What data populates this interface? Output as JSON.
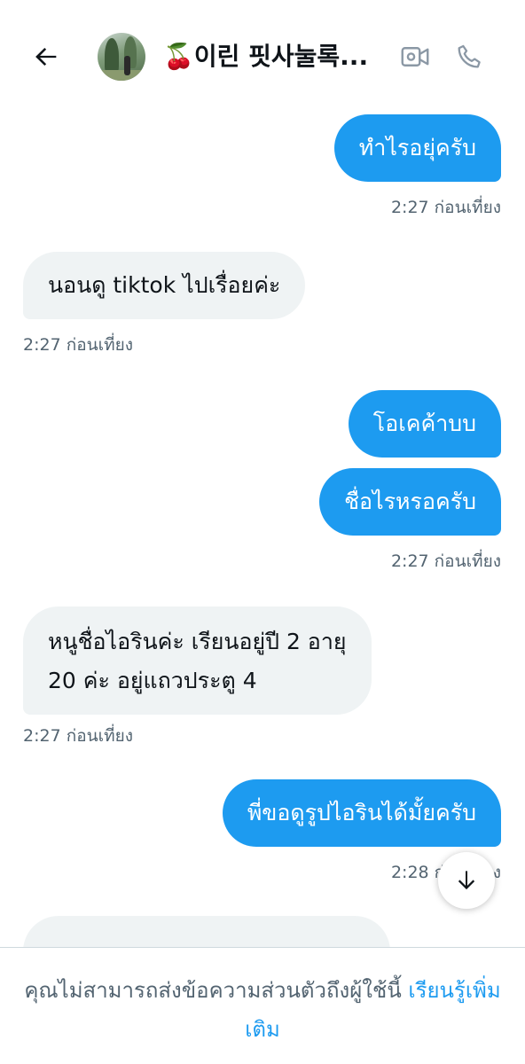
{
  "header": {
    "back_icon": "arrow-left-icon",
    "title": "🍒이린 핏사눌록...",
    "video_icon": "video-camera-icon",
    "call_icon": "phone-icon"
  },
  "messages": [
    {
      "direction": "outgoing",
      "text": "ทำไรอยุ่ครับ"
    },
    {
      "timestamp": "2:27 ก่อนเที่ยง"
    },
    {
      "direction": "incoming",
      "text": "นอนดู tiktok ไปเรื่อยค่ะ"
    },
    {
      "timestamp": "2:27 ก่อนเที่ยง"
    },
    {
      "direction": "outgoing",
      "text": "โอเคค้าบบ"
    },
    {
      "direction": "outgoing",
      "text": "ชื่อไรหรอครับ"
    },
    {
      "timestamp": "2:27 ก่อนเที่ยง"
    },
    {
      "direction": "incoming",
      "lines": [
        "หนูชื่อไอรินค่ะ เรียนอยู่ปี 2 อายุ",
        "20 ค่ะ อยู่แถวประตู 4"
      ]
    },
    {
      "timestamp": "2:27 ก่อนเที่ยง"
    },
    {
      "direction": "outgoing",
      "text": "พี่ขอดูรูปไอรินได้มั้ยครับ"
    },
    {
      "timestamp": "2:28 ก่อนเที่ยง"
    }
  ],
  "scroll_down_icon": "arrow-down-icon",
  "footer": {
    "notice": "คุณไม่สามารถส่งข้อความส่วนตัวถึงผู้ใช้นี้ ",
    "link": "เรียนรู้เพิ่มเติม"
  },
  "colors": {
    "accent": "#1d9bf0",
    "incoming_bubble": "#eff3f4",
    "muted_text": "#536471"
  }
}
